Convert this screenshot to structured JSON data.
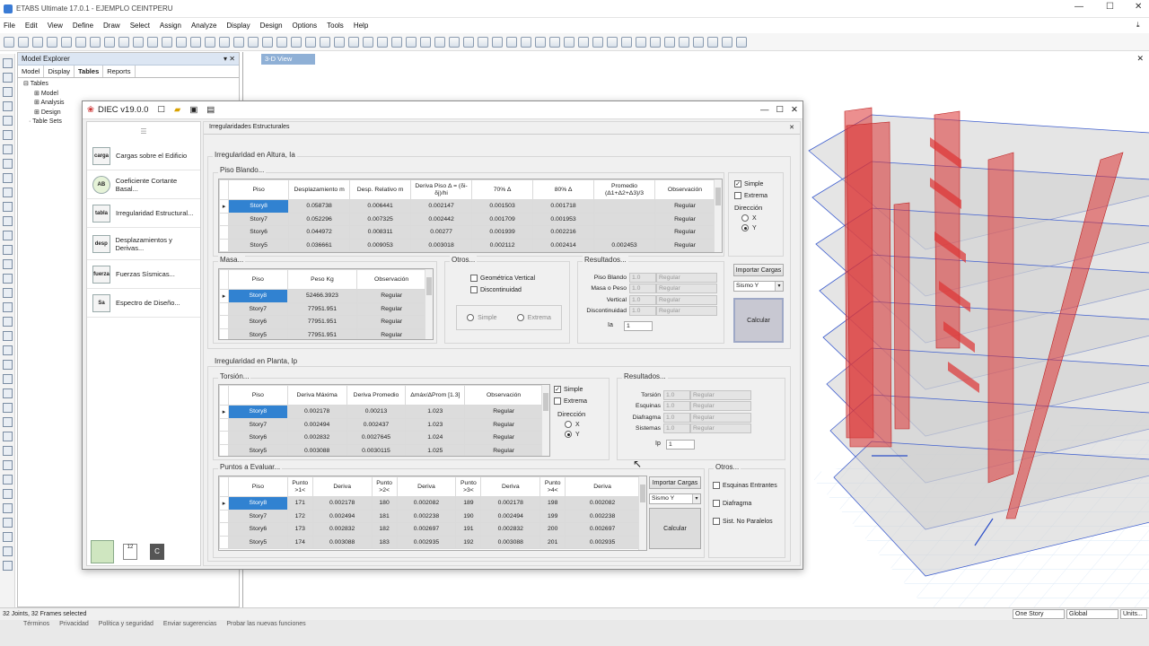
{
  "app": {
    "title": "ETABS Ultimate 17.0.1 - EJEMPLO CEINTPERU",
    "menu": [
      "File",
      "Edit",
      "View",
      "Define",
      "Draw",
      "Select",
      "Assign",
      "Analyze",
      "Display",
      "Design",
      "Options",
      "Tools",
      "Help"
    ]
  },
  "explorer": {
    "title": "Model Explorer",
    "tabs": [
      "Model",
      "Display",
      "Tables",
      "Reports"
    ],
    "tree": [
      "Tables",
      "Model",
      "Analysis",
      "Design",
      "Table Sets"
    ]
  },
  "view": {
    "tab": "3-D View"
  },
  "status": {
    "left": "32 Joints, 32 Frames selected",
    "story": "One Story",
    "coord": "Global",
    "units": "Units..."
  },
  "taskbar": [
    "Términos",
    "Privacidad",
    "Política y seguridad",
    "Enviar sugerencias",
    "Probar las nuevas funciones"
  ],
  "diec": {
    "title": "DIEC v19.0.0",
    "side": [
      "Cargas sobre el Edificio",
      "Coeficiente Cortante Basal...",
      "Irregularidad Estructural...",
      "Desplazamientos y Derivas...",
      "Fuerzas Sísmicas...",
      "Espectro de Diseño..."
    ],
    "side_icons": [
      "carga",
      "AB",
      "tabla",
      "desp",
      "fuerza",
      "Sa"
    ],
    "tab": "Irregularidades Estructurales",
    "altura_title": "Irregularidad en Altura, Ia",
    "piso_blando": {
      "title": "Piso Blando...",
      "headers": [
        "Piso",
        "Desplazamiento m",
        "Desp. Relativo m",
        "Deriva Piso Δ = (δi-δj)/hi",
        "70% Δ",
        "80% Δ",
        "Promedio (Δ1+Δ2+Δ3)/3",
        "Observación"
      ],
      "rows": [
        [
          "Story8",
          "0.058738",
          "0.006441",
          "0.002147",
          "0.001503",
          "0.001718",
          "",
          "Regular"
        ],
        [
          "Story7",
          "0.052296",
          "0.007325",
          "0.002442",
          "0.001709",
          "0.001953",
          "",
          "Regular"
        ],
        [
          "Story6",
          "0.044972",
          "0.008311",
          "0.00277",
          "0.001939",
          "0.002216",
          "",
          "Regular"
        ],
        [
          "Story5",
          "0.036661",
          "0.009053",
          "0.003018",
          "0.002112",
          "0.002414",
          "0.002453",
          "Regular"
        ]
      ]
    },
    "masa": {
      "title": "Masa...",
      "headers": [
        "Piso",
        "Peso Kg",
        "Observación"
      ],
      "rows": [
        [
          "Story8",
          "52466.3923",
          "Regular"
        ],
        [
          "Story7",
          "77951.951",
          "Regular"
        ],
        [
          "Story6",
          "77951.951",
          "Regular"
        ],
        [
          "Story5",
          "77951.951",
          "Regular"
        ]
      ]
    },
    "otros_altura": {
      "title": "Otros...",
      "geom": "Geométrica Vertical",
      "disc": "Discontinuidad",
      "simple": "Simple",
      "extrema": "Extrema"
    },
    "resultados_altura": {
      "title": "Resultados...",
      "rows": [
        [
          "Piso Blando",
          "1.0",
          "Regular"
        ],
        [
          "Masa o Peso",
          "1.0",
          "Regular"
        ],
        [
          "Vertical",
          "1.0",
          "Regular"
        ],
        [
          "Discontinuidad",
          "1.0",
          "Regular"
        ]
      ],
      "ia_label": "Ia",
      "ia_value": "1"
    },
    "opts_altura": {
      "simple": "Simple",
      "extrema": "Extrema",
      "direccion": "Dirección",
      "x": "X",
      "y": "Y"
    },
    "importar1": {
      "button": "Importar Cargas",
      "combo": "Sismo Y",
      "calcular": "Calcular"
    },
    "planta_title": "Irregularidad en Planta, Ip",
    "torsion": {
      "title": "Torsión...",
      "headers": [
        "Piso",
        "Deriva Máxima",
        "Deriva Promedio",
        "Δmáx/ΔProm [1.3]",
        "Observación"
      ],
      "rows": [
        [
          "Story8",
          "0.002178",
          "0.00213",
          "1.023",
          "Regular"
        ],
        [
          "Story7",
          "0.002494",
          "0.002437",
          "1.023",
          "Regular"
        ],
        [
          "Story6",
          "0.002832",
          "0.0027645",
          "1.024",
          "Regular"
        ],
        [
          "Story5",
          "0.003088",
          "0.0030115",
          "1.025",
          "Regular"
        ]
      ]
    },
    "opts_planta": {
      "simple": "Simple",
      "extrema": "Extrema",
      "direccion": "Dirección",
      "x": "X",
      "y": "Y"
    },
    "resultados_planta": {
      "title": "Resultados...",
      "rows": [
        [
          "Torsión",
          "1.0",
          "Regular"
        ],
        [
          "Esquinas",
          "1.0",
          "Regular"
        ],
        [
          "Diafragma",
          "1.0",
          "Regular"
        ],
        [
          "Sistemas",
          "1.0",
          "Regular"
        ]
      ],
      "ip_label": "Ip",
      "ip_value": "1"
    },
    "puntos": {
      "title": "Puntos a Evaluar...",
      "headers": [
        "Piso",
        "Punto >1<",
        "Deriva",
        "Punto >2<",
        "Deriva",
        "Punto >3<",
        "Deriva",
        "Punto >4<",
        "Deriva"
      ],
      "rows": [
        [
          "Story8",
          "171",
          "0.002178",
          "180",
          "0.002082",
          "189",
          "0.002178",
          "198",
          "0.002082"
        ],
        [
          "Story7",
          "172",
          "0.002494",
          "181",
          "0.002238",
          "190",
          "0.002494",
          "199",
          "0.002238"
        ],
        [
          "Story6",
          "173",
          "0.002832",
          "182",
          "0.002697",
          "191",
          "0.002832",
          "200",
          "0.002697"
        ],
        [
          "Story5",
          "174",
          "0.003088",
          "183",
          "0.002935",
          "192",
          "0.003088",
          "201",
          "0.002935"
        ]
      ]
    },
    "importar2": {
      "button": "Importar Cargas",
      "combo": "Sismo Y",
      "calcular": "Calcular"
    },
    "otros_planta": {
      "title": "Otros...",
      "items": [
        "Esquinas Entrantes",
        "Diafragma",
        "Sist. No Paralelos"
      ]
    },
    "footer_icons": [
      "12",
      "C"
    ]
  }
}
